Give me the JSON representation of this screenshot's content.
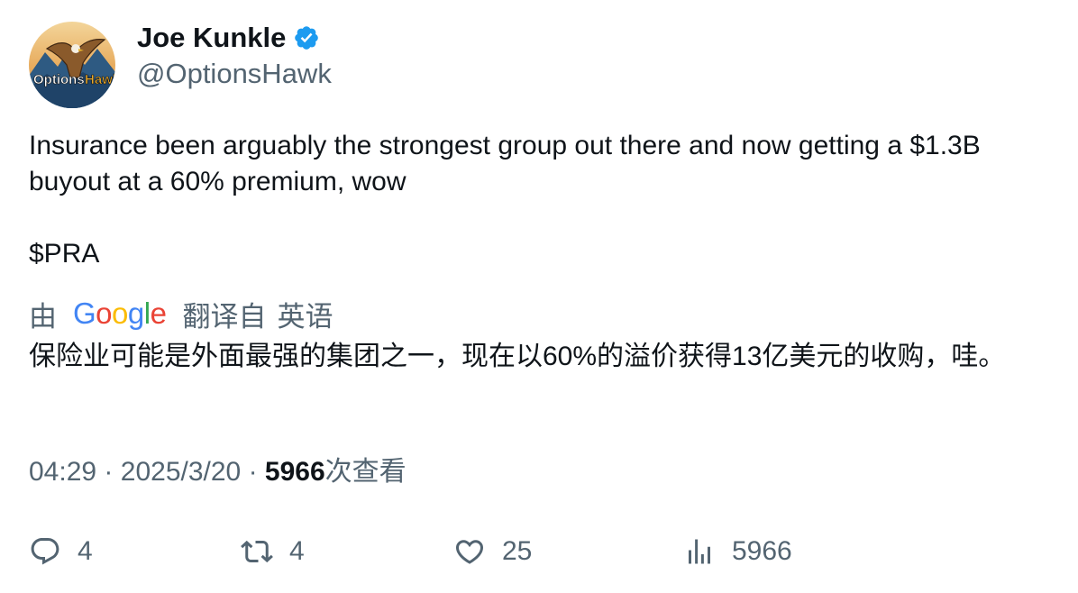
{
  "author": {
    "display_name": "Joe Kunkle",
    "handle": "@OptionsHawk",
    "verified_icon": "verified-badge-icon",
    "avatar_text": "OptionsHawk"
  },
  "tweet": {
    "text_line1": "Insurance been arguably the strongest group out there and now getting a $1.3B buyout at a 60% premium, wow",
    "text_line2": "$PRA"
  },
  "translation": {
    "by_label": "由",
    "provider": "Google",
    "translated_from": "翻译自",
    "language": "英语",
    "text": "保险业可能是外面最强的集团之一，现在以60%的溢价获得13亿美元的收购，哇。"
  },
  "meta": {
    "time": "04:29",
    "separator": "·",
    "date": "2025/3/20",
    "views_count": "5966",
    "views_label": "次查看"
  },
  "actions": {
    "reply_count": "4",
    "retweet_count": "4",
    "like_count": "25",
    "views_count": "5966"
  },
  "colors": {
    "text_primary": "#0f1419",
    "text_secondary": "#536471",
    "verified": "#1d9bf0"
  }
}
